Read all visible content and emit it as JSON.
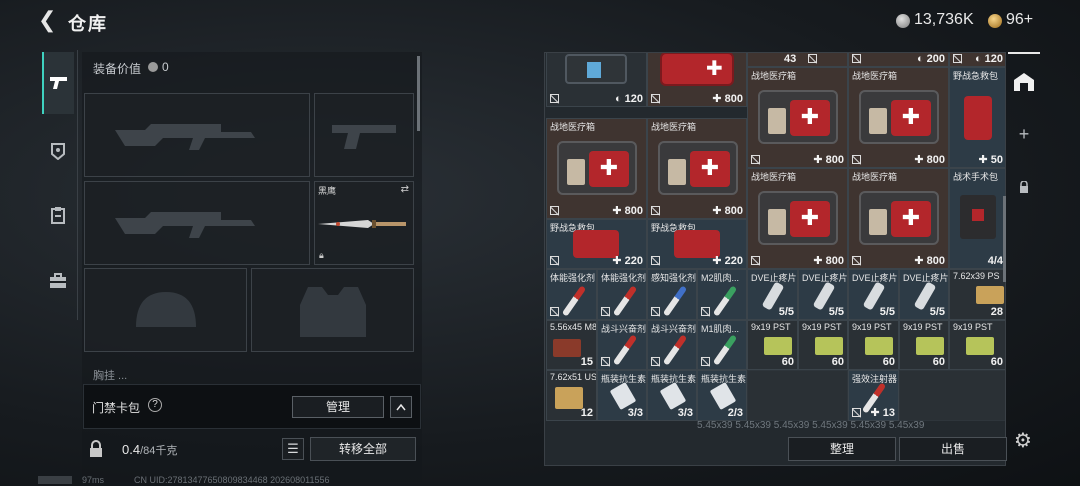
{
  "header": {
    "back_icon": "back-arrow-icon",
    "title": "仓库",
    "currency1": "13,736K",
    "currency2": "96+"
  },
  "rail": [
    "pistol-icon",
    "badge-icon",
    "clipboard-icon",
    "toolbox-icon"
  ],
  "equipment": {
    "label": "装备价值",
    "value": "0",
    "knife_label": "黑鹰",
    "partial_label": "胸挂 ..."
  },
  "cardpack": {
    "label": "门禁卡包",
    "help": "?",
    "manage": "管理",
    "collapse": "^"
  },
  "footer_left": {
    "weight": "0.4",
    "weight_max": "/84千克",
    "transfer": "转移全部"
  },
  "status": {
    "ping": "97ms",
    "uid": "CN UID:27813477650809834468  202608011556"
  },
  "storage": {
    "top_counts": [
      "43",
      "200",
      "120"
    ],
    "cells": [
      {
        "label": "",
        "count": "120",
        "kind": "case"
      },
      {
        "label": "",
        "count": "800",
        "kind": "medkit"
      },
      {
        "label": "战地医疗箱",
        "count": "800"
      },
      {
        "label": "战地医疗箱",
        "count": "800"
      },
      {
        "label": "野战急救包",
        "count": "50"
      },
      {
        "label": "战地医疗箱",
        "count": "800"
      },
      {
        "label": "战地医疗箱",
        "count": "800"
      },
      {
        "label": "战地医疗箱",
        "count": "800"
      },
      {
        "label": "战地医疗箱",
        "count": "800"
      },
      {
        "label": "战术手术包",
        "count": "4/4"
      },
      {
        "label": "野战急救包",
        "count": "220"
      },
      {
        "label": "野战急救包",
        "count": "220"
      },
      {
        "label": "体能强化剂",
        "count": ""
      },
      {
        "label": "体能强化剂",
        "count": ""
      },
      {
        "label": "感知强化剂",
        "count": ""
      },
      {
        "label": "M2肌肉...",
        "count": ""
      },
      {
        "label": "DVE止疼片",
        "count": "5/5"
      },
      {
        "label": "DVE止疼片",
        "count": "5/5"
      },
      {
        "label": "DVE止疼片",
        "count": "5/5"
      },
      {
        "label": "DVE止疼片",
        "count": "5/5"
      },
      {
        "label": "7.62x39 PS",
        "count": "28"
      },
      {
        "label": "5.56x45 M855",
        "count": "15"
      },
      {
        "label": "战斗兴奋剂",
        "count": ""
      },
      {
        "label": "战斗兴奋剂",
        "count": ""
      },
      {
        "label": "M1肌肉...",
        "count": ""
      },
      {
        "label": "9x19 PST",
        "count": "60"
      },
      {
        "label": "9x19 PST",
        "count": "60"
      },
      {
        "label": "9x19 PST",
        "count": "60"
      },
      {
        "label": "9x19 PST",
        "count": "60"
      },
      {
        "label": "9x19 PST",
        "count": "60"
      },
      {
        "label": "7.62x51 US",
        "count": "12"
      },
      {
        "label": "瓶装抗生素",
        "count": "3/3"
      },
      {
        "label": "瓶装抗生素",
        "count": "3/3"
      },
      {
        "label": "瓶装抗生素",
        "count": "2/3"
      },
      {
        "label": "强效注射器",
        "count": "13"
      }
    ],
    "bottom_row": "5.45x39        5.45x39        5.45x39        5.45x39        5.45x39        5.45x39"
  },
  "actions": {
    "sort": "整理",
    "sell": "出售"
  },
  "right_rail": {
    "plus": "+"
  }
}
